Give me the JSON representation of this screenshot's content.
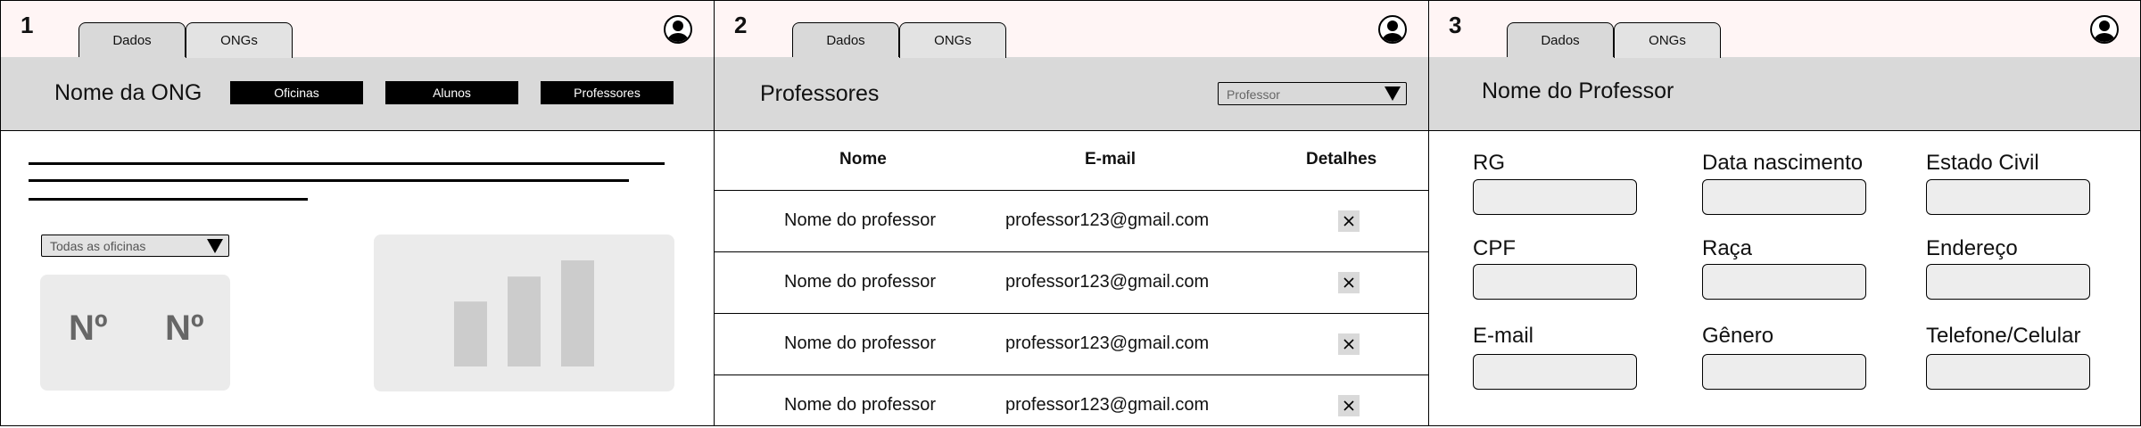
{
  "frames": [
    {
      "number": "1",
      "tabs": [
        "Dados",
        "ONGs"
      ],
      "active_tab": "ONGs",
      "header": {
        "title": "Nome da ONG",
        "buttons": [
          "Oficinas",
          "Alunos",
          "Professores"
        ]
      },
      "filter_select": {
        "value": "Todas as oficinas"
      },
      "stats": [
        "Nº",
        "Nº"
      ],
      "chart_data": {
        "type": "bar",
        "values": [
          0.52,
          0.72,
          0.85
        ],
        "color": "#cccccc"
      }
    },
    {
      "number": "2",
      "tabs": [
        "Dados",
        "ONGs"
      ],
      "active_tab": "ONGs",
      "header": {
        "title": "Professores",
        "select": {
          "value": "Professor"
        }
      },
      "table": {
        "columns": [
          "Nome",
          "E-mail",
          "Detalhes"
        ],
        "rows": [
          {
            "nome": "Nome do professor",
            "email": "professor123@gmail.com"
          },
          {
            "nome": "Nome do professor",
            "email": "professor123@gmail.com"
          },
          {
            "nome": "Nome do professor",
            "email": "professor123@gmail.com"
          },
          {
            "nome": "Nome do professor",
            "email": "professor123@gmail.com"
          }
        ],
        "detail_icon": "close-icon"
      }
    },
    {
      "number": "3",
      "tabs": [
        "Dados",
        "ONGs"
      ],
      "active_tab": "ONGs",
      "header": {
        "title": "Nome do Professor"
      },
      "fields": [
        [
          "RG",
          "Data nascimento",
          "Estado Civil"
        ],
        [
          "CPF",
          "Raça",
          "Endereço"
        ],
        [
          "E-mail",
          "Gênero",
          "Telefone/Celular"
        ]
      ]
    }
  ],
  "colors": {
    "header_band": "#d9d9d9",
    "topbar": "#fff5f5",
    "button_black": "#000000",
    "card": "#ebebeb"
  },
  "icons": {
    "profile": "user-icon",
    "select": "caret-down-icon",
    "details": "close-icon"
  }
}
